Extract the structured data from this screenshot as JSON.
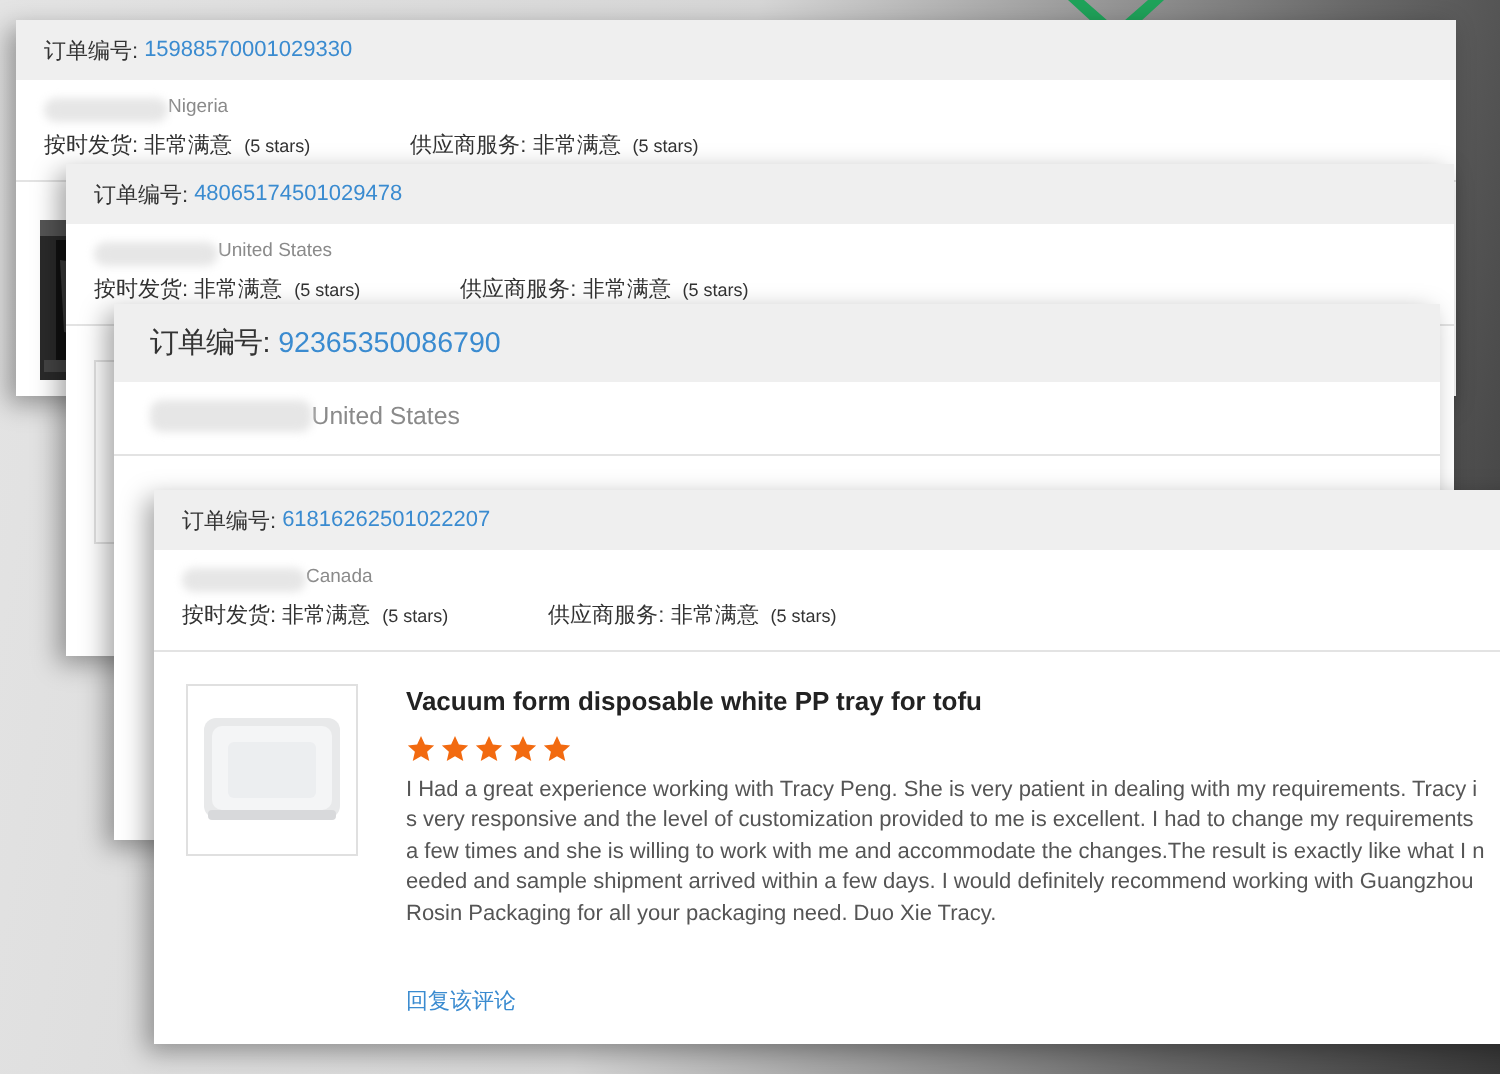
{
  "reviews": [
    {
      "order_label": "订单编号:",
      "order_number": "15988570001029330",
      "country": "Nigeria",
      "ratings": [
        {
          "label": "按时发货:",
          "value": "非常满意",
          "stars_text": "(5 stars)"
        },
        {
          "label": "供应商服务:",
          "value": "非常满意",
          "stars_text": "(5 stars)"
        }
      ]
    },
    {
      "order_label": "订单编号:",
      "order_number": "48065174501029478",
      "country": "United States",
      "ratings": [
        {
          "label": "按时发货:",
          "value": "非常满意",
          "stars_text": "(5 stars)"
        },
        {
          "label": "供应商服务:",
          "value": "非常满意",
          "stars_text": "(5 stars)"
        }
      ]
    },
    {
      "order_label": "订单编号:",
      "order_number": "92365350086790",
      "country": "United States"
    },
    {
      "order_label": "订单编号:",
      "order_number": "61816262501022207",
      "country": "Canada",
      "ratings": [
        {
          "label": "按时发货:",
          "value": "非常满意",
          "stars_text": "(5 stars)"
        },
        {
          "label": "供应商服务:",
          "value": "非常满意",
          "stars_text": "(5 stars)"
        }
      ],
      "product": {
        "title": "Vacuum form disposable white PP tray for tofu",
        "stars": 5,
        "review": "I Had a great experience working with Tracy Peng. She is very patient in dealing with my requirements. Tracy is very responsive and  the level of customization provided to me is excellent. I had to change my requirements a few times and she is willing to work with me and accommodate the changes.The result is exactly like what I needed and sample shipment arrived within a few days. I would definitely recommend working with Guangzhou Rosin Packaging for all your packaging need. Duo Xie Tracy.",
        "reply_link": "回复该评论"
      }
    }
  ]
}
